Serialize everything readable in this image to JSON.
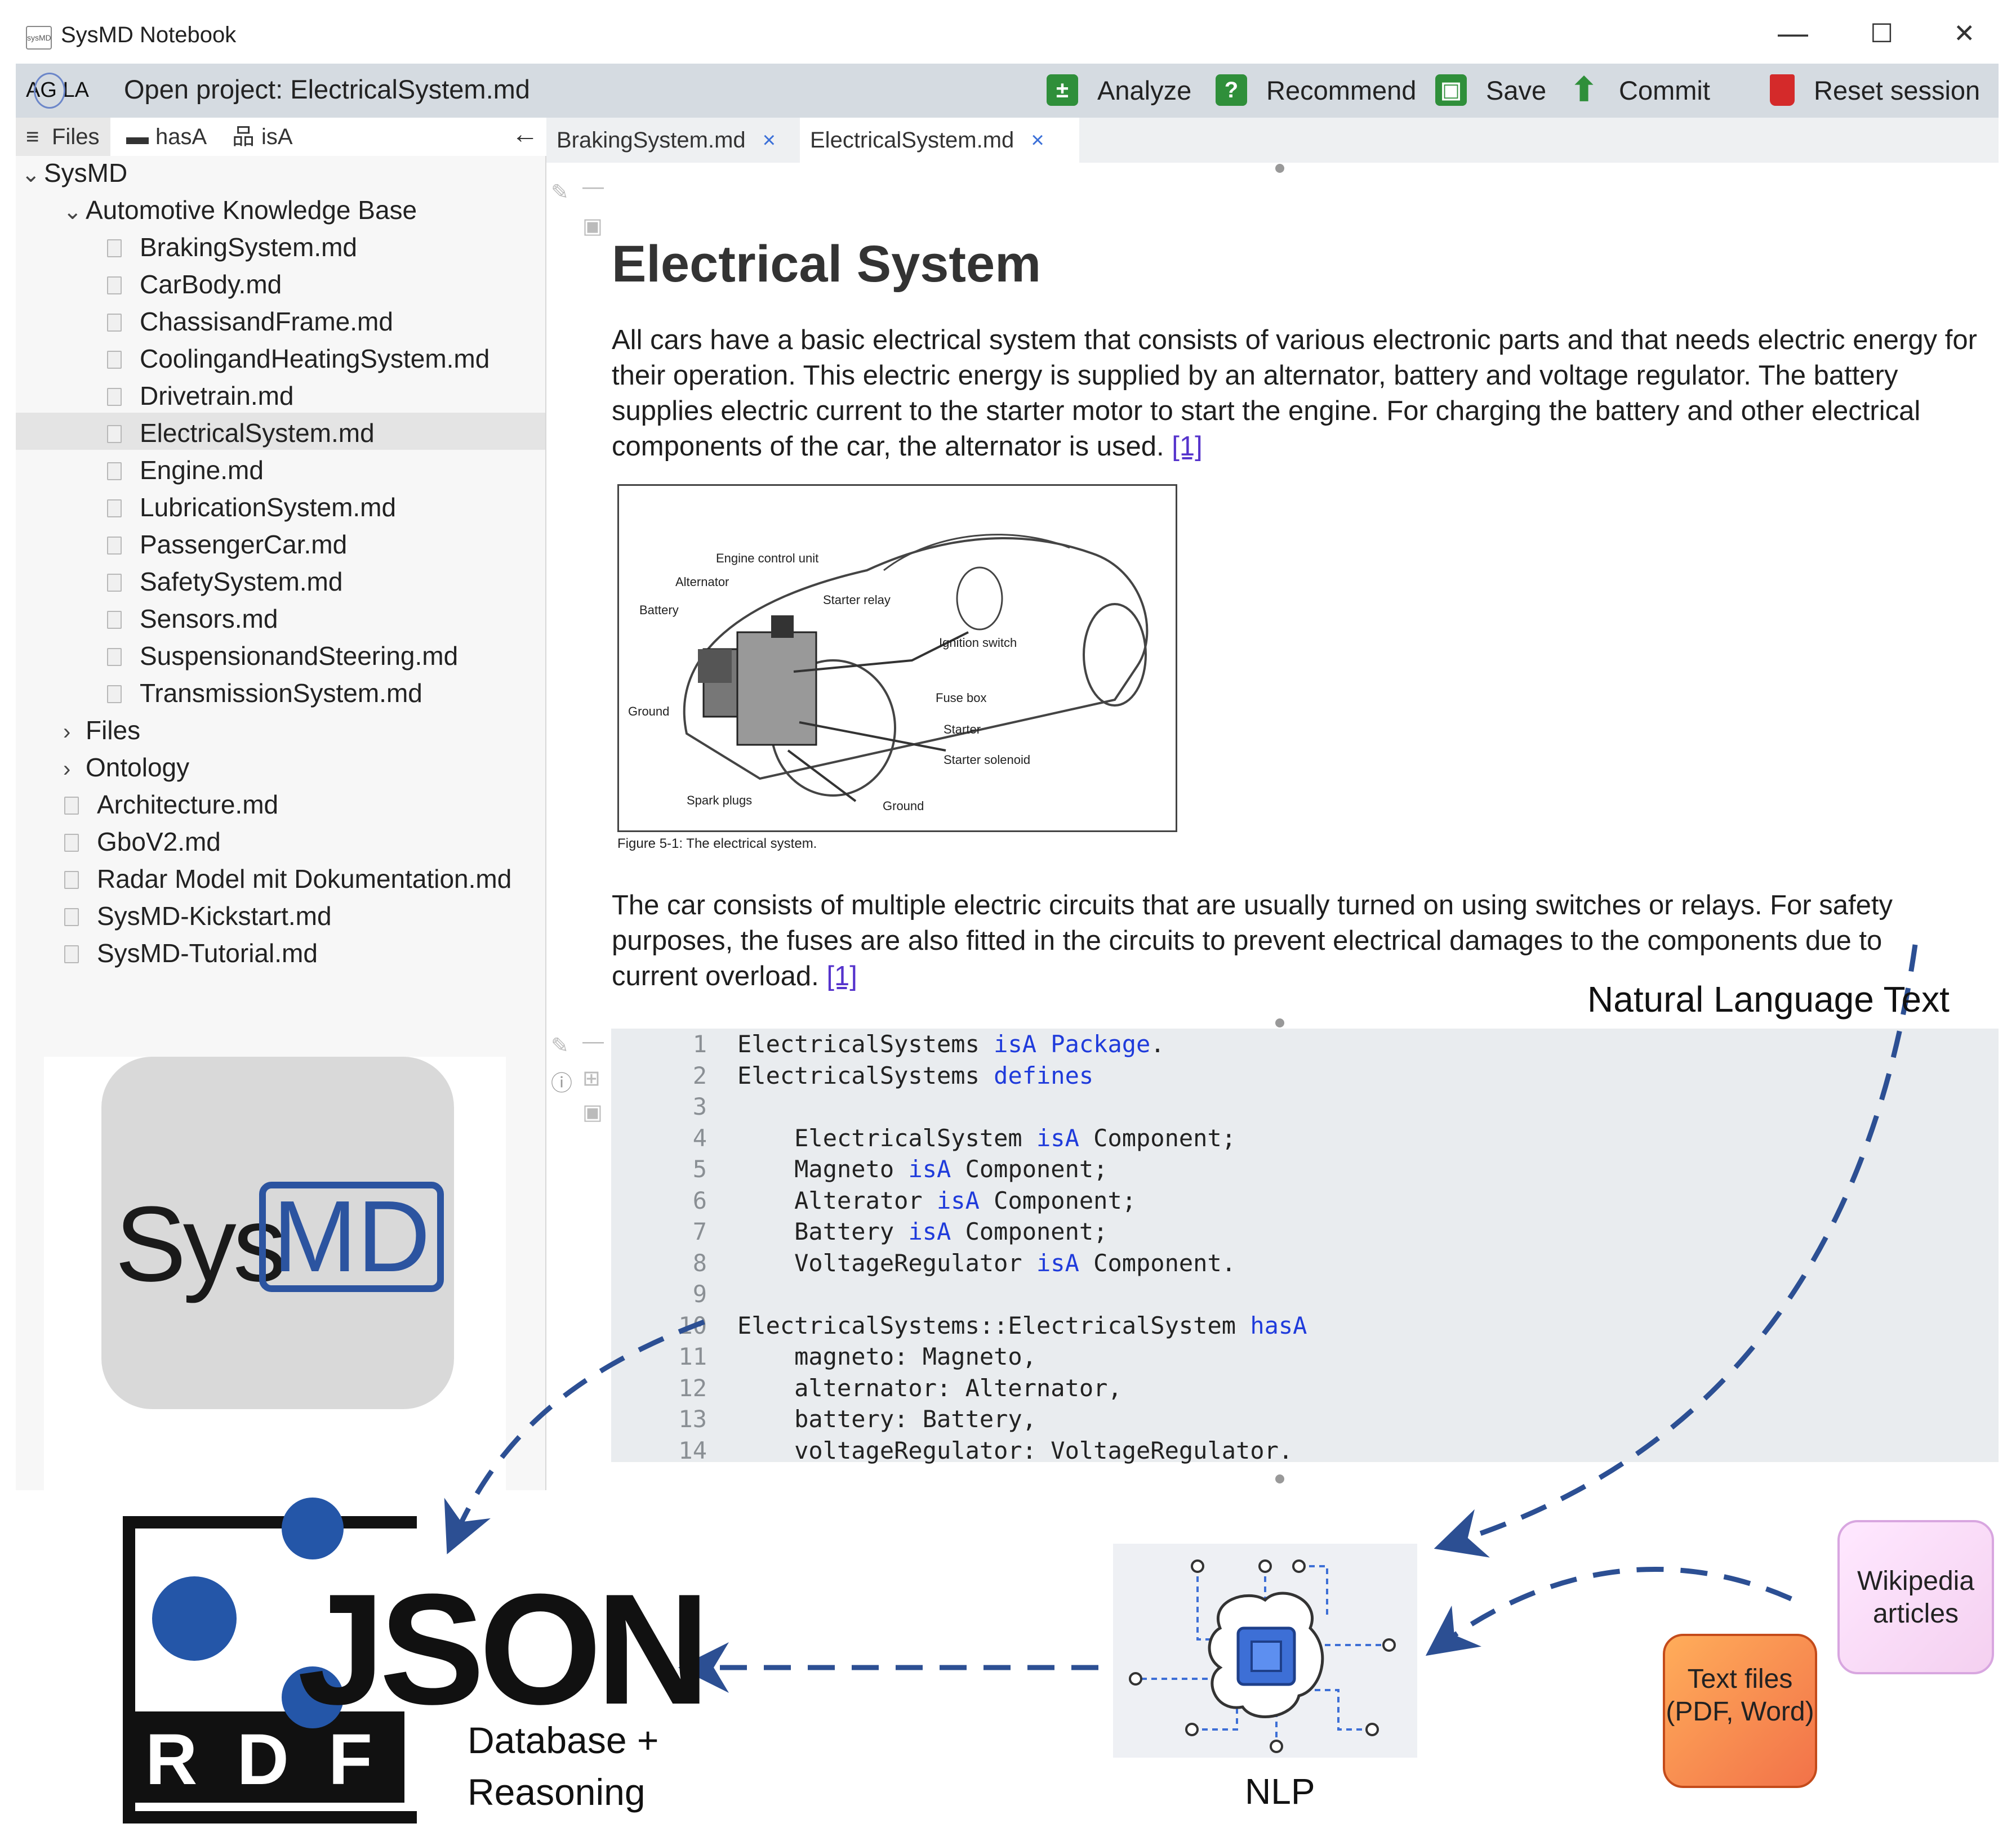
{
  "window": {
    "title": "SysMD Notebook",
    "app_icon": "sysMD",
    "controls": [
      "—",
      "☐",
      "✕"
    ]
  },
  "toolbar": {
    "logo": "AG LA",
    "open_project": "Open project: ElectricalSystem.md",
    "buttons": [
      {
        "label": "Analyze",
        "icon": "analyze-icon",
        "color": "#2f8f3a"
      },
      {
        "label": "Recommend",
        "icon": "help-icon",
        "color": "#2f8f3a"
      },
      {
        "label": "Save",
        "icon": "save-icon",
        "color": "#2f8f3a"
      },
      {
        "label": "Commit",
        "icon": "upload-icon",
        "color": "#2f8f3a"
      },
      {
        "label": "Reset session",
        "icon": "trash-icon",
        "color": "#d42a2a"
      }
    ]
  },
  "side_tabs": [
    "Files",
    "hasA",
    "isA"
  ],
  "tree": {
    "root": "SysMD",
    "folder": "Automotive Knowledge Base",
    "kb_files": [
      "BrakingSystem.md",
      "CarBody.md",
      "ChassisandFrame.md",
      "CoolingandHeatingSystem.md",
      "Drivetrain.md",
      "ElectricalSystem.md",
      "Engine.md",
      "LubricationSystem.md",
      "PassengerCar.md",
      "SafetySystem.md",
      "Sensors.md",
      "SuspensionandSteering.md",
      "TransmissionSystem.md"
    ],
    "folders": [
      "Files",
      "Ontology"
    ],
    "root_files": [
      "Architecture.md",
      "GboV2.md",
      "Radar Model mit Dokumentation.md",
      "SysMD-Kickstart.md",
      "SysMD-Tutorial.md"
    ],
    "selected": "ElectricalSystem.md"
  },
  "sysmd_logo": {
    "sys": "Sys",
    "md": "MD"
  },
  "editor_tabs": [
    {
      "label": "BrakingSystem.md",
      "close": "×"
    },
    {
      "label": "ElectricalSystem.md",
      "close": "×"
    }
  ],
  "document": {
    "title": "Electrical System",
    "para1": "All cars have a basic electrical system that consists of various electronic parts and that needs electric energy for their operation. This electric energy is supplied by an alternator, battery and voltage regulator. The battery supplies electric current to the starter motor to start the engine. For charging the battery and other electrical components of the car, the alternator is used.",
    "para2": "The car consists of multiple electric circuits that are usually turned on using switches or relays. For safety purposes, the fuses are also fitted in the circuits to prevent electrical damages to the components due to current overload.",
    "citation": "[1]",
    "figure_caption": "Figure 5-1: The electrical system.",
    "figure_labels": [
      "Engine control unit",
      "Alternator",
      "Battery",
      "Starter relay",
      "Ignition switch",
      "Fuse box",
      "Ground",
      "Starter",
      "Starter solenoid",
      "Spark plugs",
      "Ground"
    ]
  },
  "code": [
    {
      "n": "1",
      "parts": [
        [
          "ElectricalSystems ",
          ""
        ],
        [
          "isA Package",
          "kw"
        ],
        [
          ".",
          ""
        ]
      ]
    },
    {
      "n": "2",
      "parts": [
        [
          "ElectricalSystems ",
          ""
        ],
        [
          "defines",
          "kw"
        ]
      ]
    },
    {
      "n": "3",
      "parts": []
    },
    {
      "n": "4",
      "parts": [
        [
          "    ElectricalSystem ",
          ""
        ],
        [
          "isA",
          "kw"
        ],
        [
          " Component;",
          ""
        ]
      ]
    },
    {
      "n": "5",
      "parts": [
        [
          "    Magneto ",
          ""
        ],
        [
          "isA",
          "kw"
        ],
        [
          " Component;",
          ""
        ]
      ]
    },
    {
      "n": "6",
      "parts": [
        [
          "    Alterator ",
          ""
        ],
        [
          "isA",
          "kw"
        ],
        [
          " Component;",
          ""
        ]
      ]
    },
    {
      "n": "7",
      "parts": [
        [
          "    Battery ",
          ""
        ],
        [
          "isA",
          "kw"
        ],
        [
          " Component;",
          ""
        ]
      ]
    },
    {
      "n": "8",
      "parts": [
        [
          "    VoltageRegulator ",
          ""
        ],
        [
          "isA",
          "kw"
        ],
        [
          " Component.",
          ""
        ]
      ]
    },
    {
      "n": "9",
      "parts": []
    },
    {
      "n": "10",
      "parts": [
        [
          "ElectricalSystems::ElectricalSystem ",
          ""
        ],
        [
          "hasA",
          "kw"
        ]
      ]
    },
    {
      "n": "11",
      "parts": [
        [
          "    magneto: Magneto,",
          ""
        ]
      ]
    },
    {
      "n": "12",
      "parts": [
        [
          "    alternator: Alternator,",
          ""
        ]
      ]
    },
    {
      "n": "13",
      "parts": [
        [
          "    battery: Battery,",
          ""
        ]
      ]
    },
    {
      "n": "14",
      "parts": [
        [
          "    voltageRegulator: VoltageRegulator.",
          ""
        ]
      ]
    }
  ],
  "diagram": {
    "natural_language": "Natural Language Text",
    "json_logo": "JSON",
    "rdf_logo": "RDF",
    "database_line1": "Database +",
    "database_line2": "Reasoning",
    "nlp": "NLP",
    "wikipedia": "Wikipedia articles",
    "text_files": "Text files (PDF, Word)",
    "arrow_color": "#2c4f93"
  }
}
